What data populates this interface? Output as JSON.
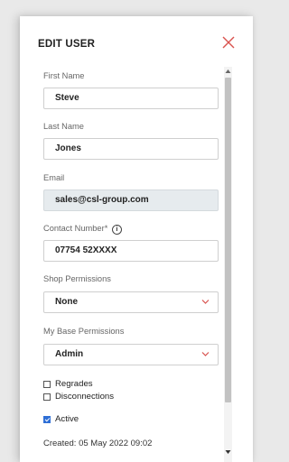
{
  "dialog": {
    "title": "EDIT USER",
    "close_icon": "close-icon",
    "accent_color": "#d9534f"
  },
  "form": {
    "first_name": {
      "label": "First Name",
      "value": "Steve"
    },
    "last_name": {
      "label": "Last Name",
      "value": "Jones"
    },
    "email": {
      "label": "Email",
      "value": "sales@csl-group.com"
    },
    "contact_number": {
      "label": "Contact Number*",
      "value": "07754 52XXXX",
      "info_icon": "info-icon"
    },
    "shop_permissions": {
      "label": "Shop Permissions",
      "value": "None"
    },
    "base_permissions": {
      "label": "My Base Permissions",
      "value": "Admin"
    },
    "checkboxes": [
      {
        "label": "Regrades",
        "checked": false
      },
      {
        "label": "Disconnections",
        "checked": false
      },
      {
        "label": "Active",
        "checked": true
      }
    ],
    "created": "Created: 05 May 2022 09:02"
  }
}
